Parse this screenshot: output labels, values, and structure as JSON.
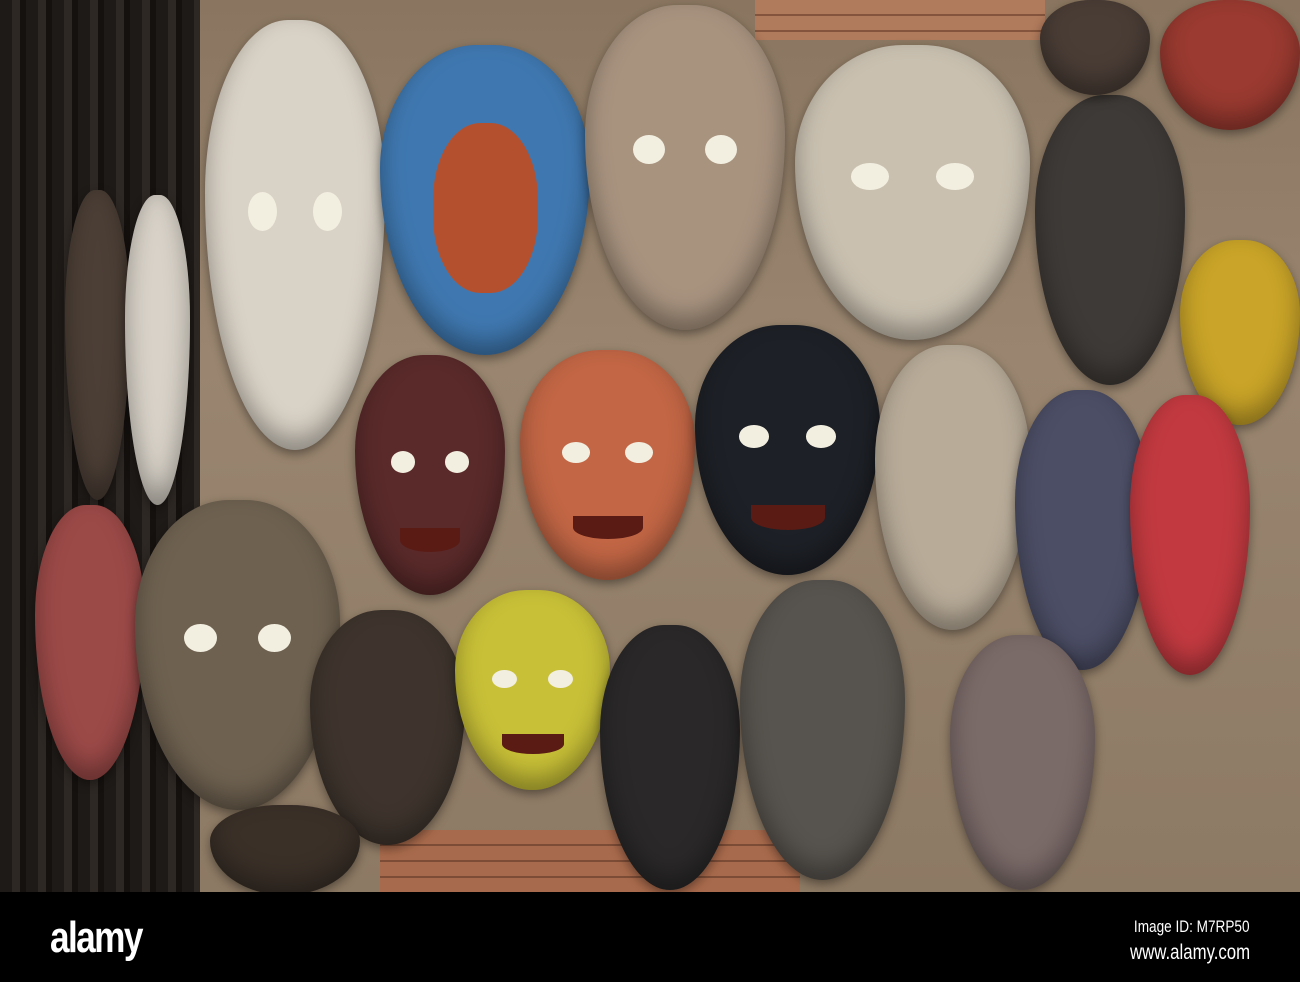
{
  "footer": {
    "logo": "alamy",
    "image_id": "Image ID: M7RP50",
    "url": "www.alamy.com"
  }
}
